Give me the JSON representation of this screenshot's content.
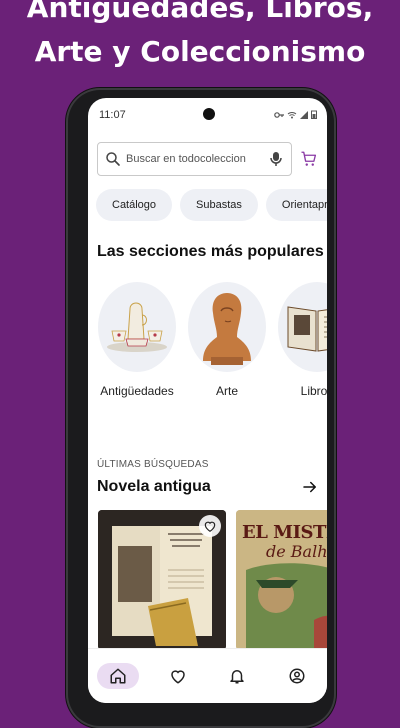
{
  "headline": {
    "line1": "Antigüedades, Libros,",
    "line2": "Arte y Coleccionismo"
  },
  "status_bar": {
    "time": "11:07"
  },
  "search": {
    "placeholder": "Buscar en todocoleccion"
  },
  "chips": [
    "Catálogo",
    "Subastas",
    "Orientaprecios"
  ],
  "popular": {
    "title": "Las secciones más populares",
    "items": [
      {
        "label": "Antigüedades",
        "icon": "porcelain-tea-set"
      },
      {
        "label": "Arte",
        "icon": "sculpture-bust"
      },
      {
        "label": "Libros",
        "icon": "open-book"
      }
    ]
  },
  "recent": {
    "overline": "ÚLTIMAS BÚSQUEDAS",
    "title": "Novela antigua",
    "cards": [
      {
        "image": "antique-book-open",
        "favorite": true
      },
      {
        "image": "el-misterio-de-balham-cover",
        "text_top": "EL MISTERIO",
        "text_sub": "de Balha",
        "favorite": false
      }
    ]
  },
  "bottom_nav": [
    {
      "icon": "home-icon",
      "active": true
    },
    {
      "icon": "heart-icon",
      "active": false
    },
    {
      "icon": "bell-icon",
      "active": false
    },
    {
      "icon": "profile-icon",
      "active": false
    }
  ],
  "colors": {
    "background": "#6b2178",
    "accent": "#8a3aa5",
    "active_nav": "#eadcf2"
  }
}
